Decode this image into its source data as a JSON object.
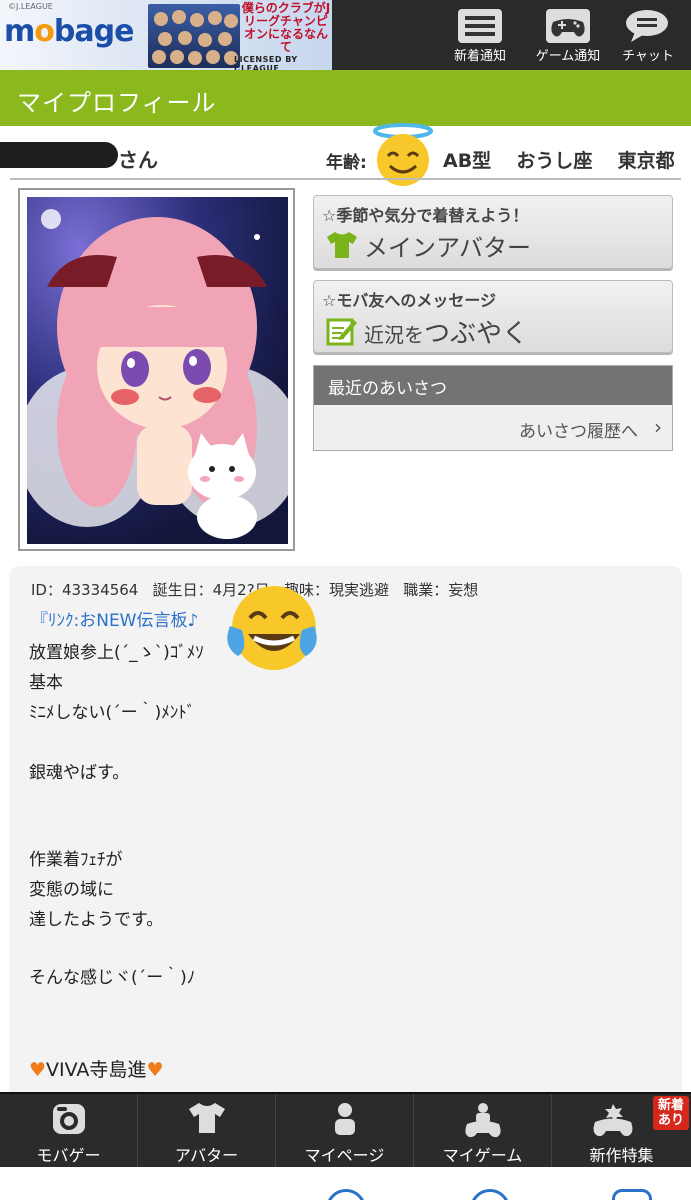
{
  "banner": {
    "jleague_tag": "©J.LEAGUE",
    "logo_left": "m",
    "logo_o": "o",
    "logo_right": "bage",
    "campaign_text": "僕らのクラブがJリーグチャンピオンになるなんて",
    "licensed": "LICENSED BY J.LEAGUE"
  },
  "header_buttons": [
    {
      "label": "新着通知",
      "icon": "news-list-icon"
    },
    {
      "label": "ゲーム通知",
      "icon": "gamepad-icon"
    },
    {
      "label": "チャット",
      "icon": "chat-bubble-icon"
    }
  ],
  "page_title": "マイプロフィール",
  "profile": {
    "name_suffix": "さん",
    "age_label": "年齢:",
    "info": "AB型  おうし座  東京都"
  },
  "actions": {
    "avatar": {
      "sub": "☆季節や気分で着替えよう！",
      "main": "メインアバター"
    },
    "status": {
      "sub": "☆モバ友へのメッセージ",
      "main_prefix": "近況を",
      "main_big": "つぶやく"
    }
  },
  "greetings": {
    "header": "最近のあいさつ",
    "link": "あいさつ履歴へ",
    "chevron": "›"
  },
  "bio": {
    "meta": "ID：43334564   誕生日：4月2?日   趣味：現実逃避   職業：妄想",
    "link": "『ﾘﾝｸ:おNEW伝言板♪",
    "lines": [
      "放置娘参上(´_ゝ`)ｺﾞﾒｿ",
      "基本",
      "ﾐﾆﾒしない(´ー｀)ﾒﾝﾄﾞ",
      "銀魂やばす。",
      "作業着ﾌｪﾁが",
      "変態の域に",
      "達したようです。",
      "そんな感じヾ(´ー｀)ﾉ"
    ],
    "viva_heart_left": "♥",
    "viva": "VIVA寺島進",
    "viva_heart_right": "♥"
  },
  "tabs": [
    {
      "label": "モバゲー",
      "icon": "mobage-icon"
    },
    {
      "label": "アバター",
      "icon": "tshirt-icon"
    },
    {
      "label": "マイページ",
      "icon": "person-icon"
    },
    {
      "label": "マイゲーム",
      "icon": "player-gamepad-icon"
    },
    {
      "label": "新作特集",
      "icon": "new-gamepad-icon",
      "badge_top": "新着",
      "badge_bottom": "あり"
    }
  ],
  "colors": {
    "title_bar": "#8ab81d",
    "link": "#2a72c9",
    "header_bg": "#2a2a2a"
  }
}
